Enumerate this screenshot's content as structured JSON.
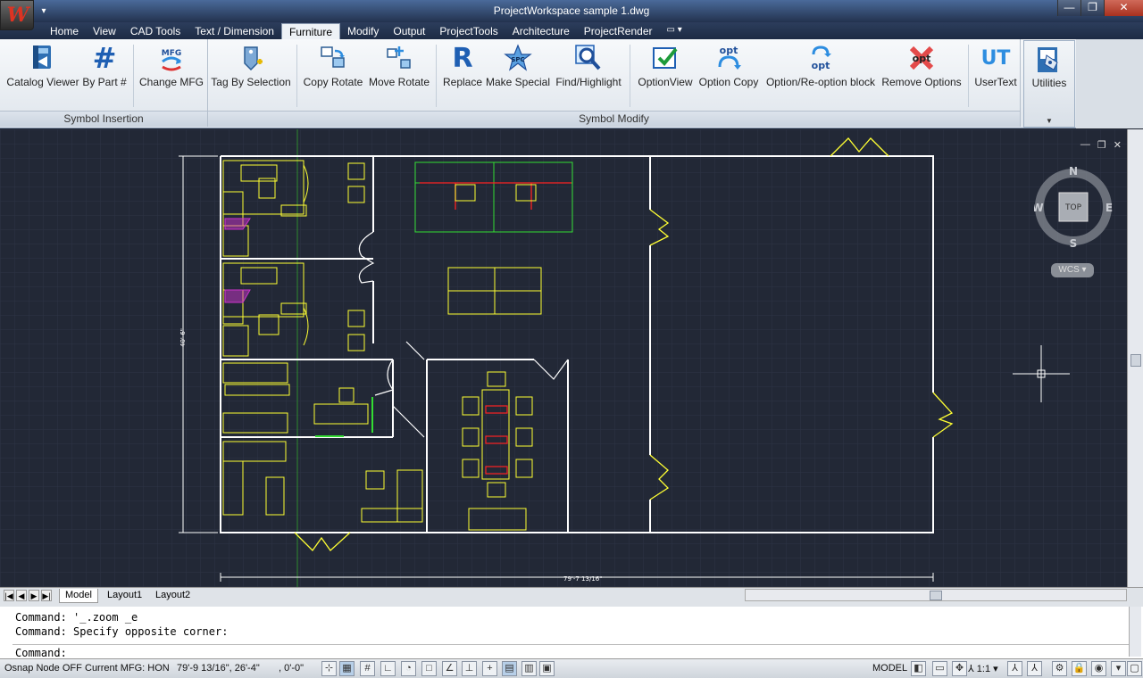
{
  "app": {
    "title": "ProjectWorkspace   sample 1.dwg",
    "logo_glyph": "W",
    "qat_dropdown": "▾",
    "window_controls": {
      "minimize": "—",
      "restore": "❐",
      "close": "✕"
    }
  },
  "tabs": [
    {
      "label": "Home"
    },
    {
      "label": "View"
    },
    {
      "label": "CAD Tools"
    },
    {
      "label": "Text / Dimension"
    },
    {
      "label": "Furniture",
      "active": true
    },
    {
      "label": "Modify"
    },
    {
      "label": "Output"
    },
    {
      "label": "ProjectTools"
    },
    {
      "label": "Architecture"
    },
    {
      "label": "ProjectRender"
    }
  ],
  "tab_extra": "▭ ▾",
  "ribbon": {
    "panels": {
      "symbol_insertion": "Symbol Insertion",
      "symbol_modify": "Symbol Modify"
    },
    "buttons": {
      "catalog_viewer": "Catalog Viewer",
      "by_part": "By Part #",
      "change_mfg": "Change MFG",
      "tag_by_selection": "Tag By Selection",
      "copy_rotate": "Copy Rotate",
      "move_rotate": "Move Rotate",
      "replace": "Replace",
      "make_special": "Make Special",
      "find_highlight": "Find/Highlight",
      "option_view": "OptionView",
      "option_copy": "Option Copy",
      "option_reoption": "Option/Re-option block",
      "remove_options": "Remove Options",
      "user_text": "UserText",
      "utilities": "Utilities"
    },
    "icon_text": {
      "by_part": "#",
      "change_mfg": "MFG",
      "replace": "R",
      "make_special": "SPC",
      "option": "opt",
      "user_text": "UT"
    },
    "icons": [
      "catalog-viewer-icon",
      "by-part-icon",
      "change-mfg-icon",
      "tag-icon",
      "copy-rotate-icon",
      "move-rotate-icon",
      "replace-icon",
      "make-special-icon",
      "find-highlight-icon",
      "option-view-icon",
      "option-copy-icon",
      "option-reoption-icon",
      "remove-options-icon",
      "user-text-icon",
      "utilities-icon"
    ]
  },
  "drawing": {
    "viewport_controls": {
      "minimize": "—",
      "restore": "❐",
      "close": "✕"
    },
    "viewcube": {
      "north": "N",
      "south": "S",
      "east": "E",
      "west": "W",
      "face": "TOP"
    },
    "wcs": "WCS ▾",
    "dimensions": {
      "horizontal": "79'-7 13/16\"",
      "vertical": "40'-6\""
    },
    "colors": {
      "background": "#222836",
      "walls": "#ffffff",
      "furniture": "#ffff33",
      "workstations": "#33dd33",
      "highlight": "#ff2222",
      "tag": "#cc33cc",
      "grid": "#2d3445"
    }
  },
  "layout_tabs": {
    "nav": [
      "|◀",
      "◀",
      "▶",
      "▶|"
    ],
    "tabs": [
      {
        "label": "Model",
        "active": true
      },
      {
        "label": "Layout1"
      },
      {
        "label": "Layout2"
      }
    ]
  },
  "command": {
    "history": [
      "Command: '_.zoom _e",
      "Command: Specify opposite corner:"
    ],
    "prompt": "Command:"
  },
  "status": {
    "osnap": "Osnap Node OFF",
    "mfg": "Current MFG: HON",
    "coords": "79'-9 13/16\", 26'-4\"",
    "z": ", 0'-0\"",
    "space": "MODEL",
    "scale": "1:1"
  }
}
